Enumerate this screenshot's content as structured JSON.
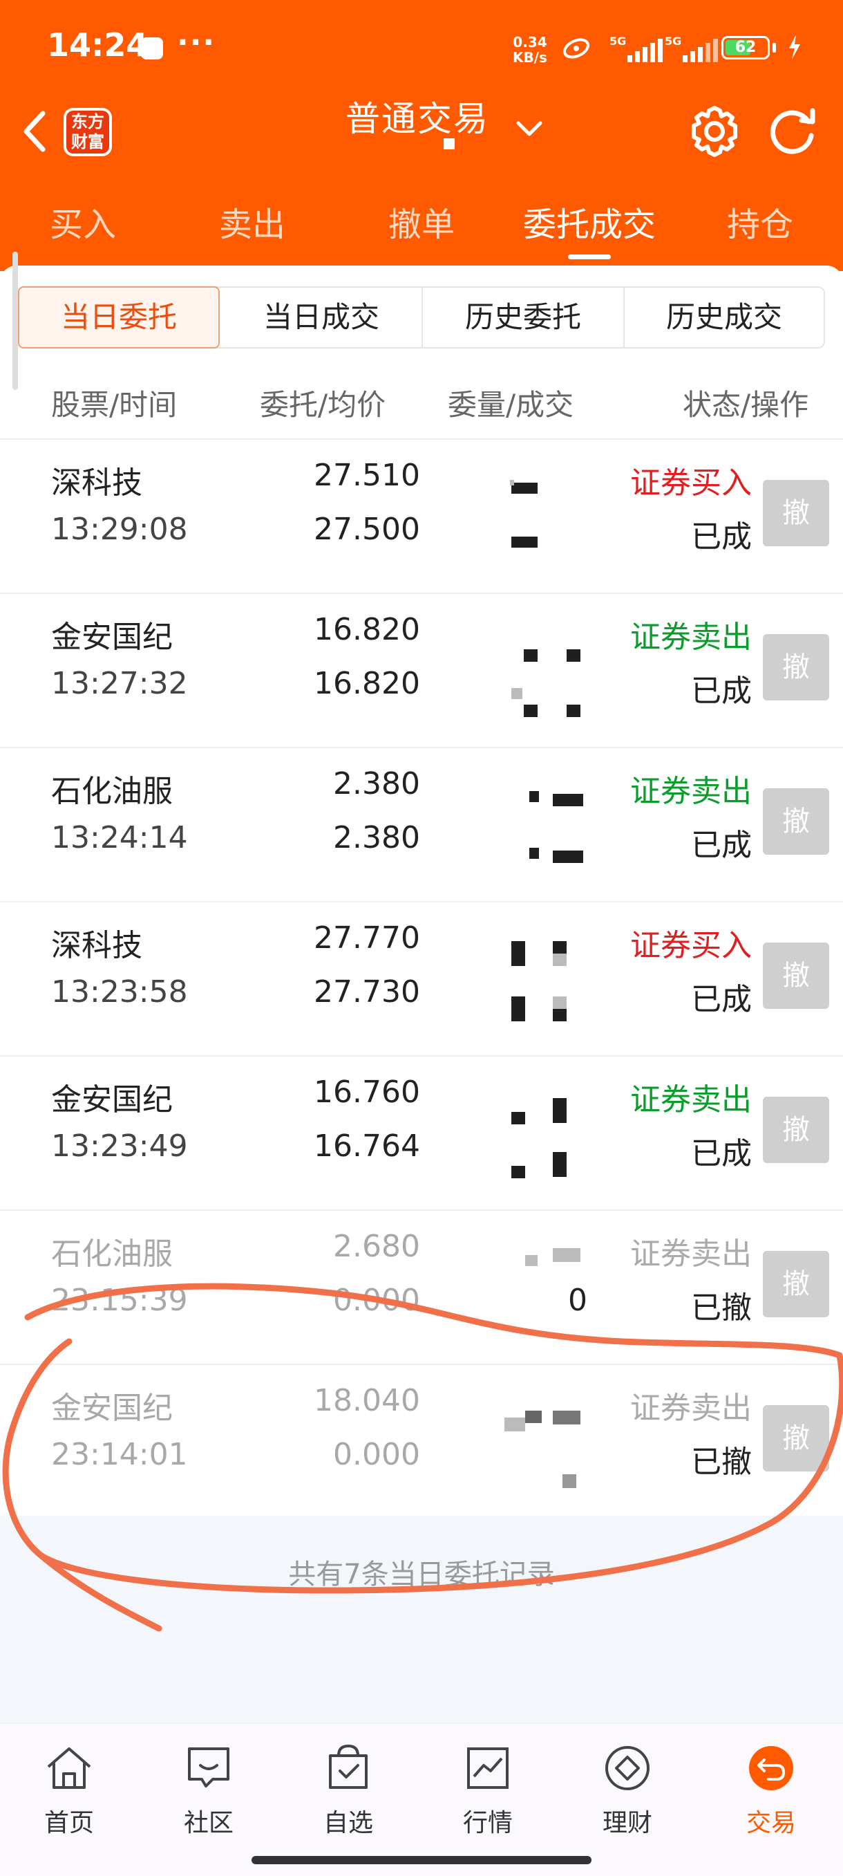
{
  "status_bar": {
    "time": "14:24",
    "dots": "···",
    "net_speed_value": "0.34",
    "net_speed_unit": "KB/s",
    "sim1": "5G",
    "sim2": "5G",
    "battery": "62",
    "battery_level": 0.62
  },
  "header": {
    "logo_line1": "东方",
    "logo_line2": "财富",
    "title": "普通交易"
  },
  "top_tabs": [
    "买入",
    "卖出",
    "撤单",
    "委托成交",
    "持仓"
  ],
  "active_tab": "委托成交",
  "sub_tabs": [
    "当日委托",
    "当日成交",
    "历史委托",
    "历史成交"
  ],
  "active_sub_tab": "当日委托",
  "columns": [
    "股票/时间",
    "委托/均价",
    "委量/成交",
    "状态/操作"
  ],
  "orders": [
    {
      "name": "深科技",
      "time": "13:29:08",
      "price": "27.510",
      "avg": "27.500",
      "qty": "",
      "filled": "",
      "type": "证券买入",
      "status": "已成",
      "action": "撤"
    },
    {
      "name": "金安国纪",
      "time": "13:27:32",
      "price": "16.820",
      "avg": "16.820",
      "qty": "",
      "filled": "",
      "type": "证券卖出",
      "status": "已成",
      "action": "撤"
    },
    {
      "name": "石化油服",
      "time": "13:24:14",
      "price": "2.380",
      "avg": "2.380",
      "qty": "",
      "filled": "",
      "type": "证券卖出",
      "status": "已成",
      "action": "撤"
    },
    {
      "name": "深科技",
      "time": "13:23:58",
      "price": "27.770",
      "avg": "27.730",
      "qty": "",
      "filled": "",
      "type": "证券买入",
      "status": "已成",
      "action": "撤"
    },
    {
      "name": "金安国纪",
      "time": "13:23:49",
      "price": "16.760",
      "avg": "16.764",
      "qty": "",
      "filled": "",
      "type": "证券卖出",
      "status": "已成",
      "action": "撤"
    },
    {
      "name": "石化油服",
      "time": "23:15:39",
      "price": "2.680",
      "avg": "0.000",
      "qty": "",
      "filled": "0",
      "type": "证券卖出",
      "status": "已撤",
      "action": "撤"
    },
    {
      "name": "金安国纪",
      "time": "23:14:01",
      "price": "18.040",
      "avg": "0.000",
      "qty": "",
      "filled": "",
      "type": "证券卖出",
      "status": "已撤",
      "action": "撤"
    }
  ],
  "summary": "共有7条当日委托记录",
  "bottom_nav": [
    "首页",
    "社区",
    "自选",
    "行情",
    "理财",
    "交易"
  ],
  "active_nav": "交易",
  "colors": {
    "brand": "#ff5a00",
    "buy": "#e02020",
    "sell": "#0a9d2b",
    "annotation": "#f0704a"
  }
}
